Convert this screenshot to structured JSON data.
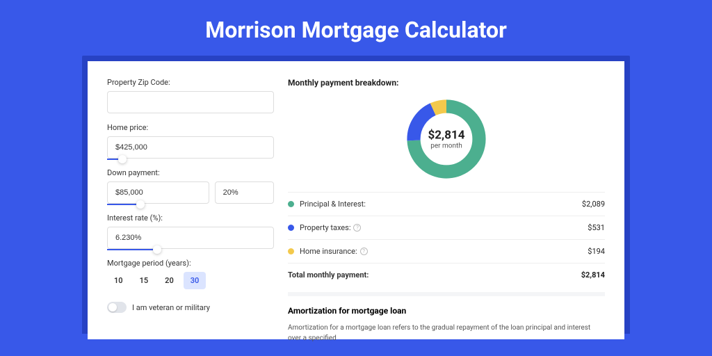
{
  "page_title": "Morrison Mortgage Calculator",
  "form": {
    "zip_label": "Property Zip Code:",
    "zip_value": "",
    "home_price_label": "Home price:",
    "home_price_value": "$425,000",
    "down_payment_label": "Down payment:",
    "down_payment_value": "$85,000",
    "down_payment_pct": "20%",
    "interest_label": "Interest rate (%):",
    "interest_value": "6.230%",
    "period_label": "Mortgage period (years):",
    "periods": [
      "10",
      "15",
      "20",
      "30"
    ],
    "period_selected": "30",
    "veteran_label": "I am veteran or military"
  },
  "breakdown": {
    "title": "Monthly payment breakdown:",
    "center_amount": "$2,814",
    "center_sub": "per month",
    "rows": [
      {
        "label": "Principal & Interest:",
        "value": "$2,089",
        "help": false
      },
      {
        "label": "Property taxes:",
        "value": "$531",
        "help": true
      },
      {
        "label": "Home insurance:",
        "value": "$194",
        "help": true
      }
    ],
    "total_label": "Total monthly payment:",
    "total_value": "$2,814"
  },
  "chart_data": {
    "type": "pie",
    "title": "Monthly payment breakdown",
    "series": [
      {
        "name": "Principal & Interest",
        "value": 2089,
        "color": "#4CAF8F"
      },
      {
        "name": "Property taxes",
        "value": 531,
        "color": "#3858E9"
      },
      {
        "name": "Home insurance",
        "value": 194,
        "color": "#F3C94C"
      }
    ],
    "total": 2814
  },
  "amort": {
    "title": "Amortization for mortgage loan",
    "text": "Amortization for a mortgage loan refers to the gradual repayment of the loan principal and interest over a specified"
  },
  "colors": {
    "green": "#4CAF8F",
    "blue": "#3858E9",
    "yellow": "#F3C94C"
  }
}
